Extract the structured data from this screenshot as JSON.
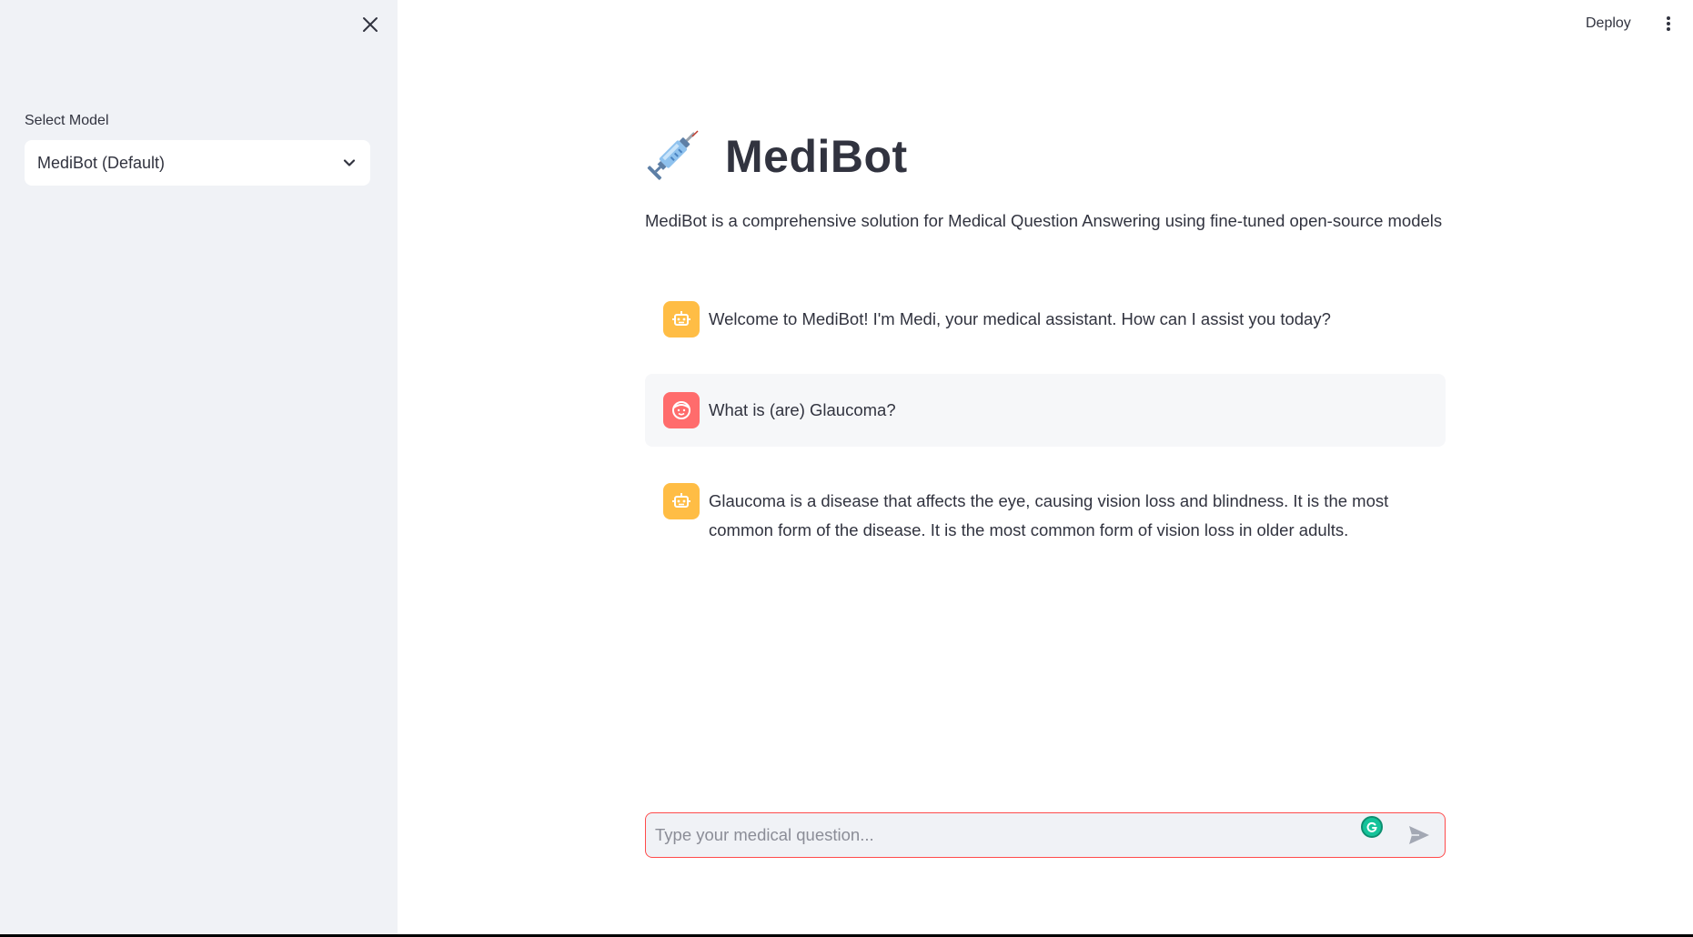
{
  "sidebar": {
    "select_label": "Select Model",
    "model_value": "MediBot (Default)"
  },
  "header": {
    "deploy_label": "Deploy"
  },
  "main": {
    "title": "MediBot",
    "description": "MediBot is a comprehensive solution for Medical Question Answering using fine-tuned open-source models"
  },
  "messages": [
    {
      "role": "assistant",
      "text": "Welcome to MediBot! I'm Medi, your medical assistant. How can I assist you today?"
    },
    {
      "role": "user",
      "text": "What is (are) Glaucoma?"
    },
    {
      "role": "assistant",
      "text": "Glaucoma is a disease that affects the eye, causing vision loss and blindness. It is the most common form of the disease. It is the most common form of vision loss in older adults."
    }
  ],
  "chat_input": {
    "placeholder": "Type your medical question...",
    "value": ""
  },
  "icons": {
    "title": "syringe-icon",
    "close": "close-icon",
    "chevron": "chevron-down-icon",
    "menu": "more-vertical-icon",
    "assistant_avatar": "robot-icon",
    "user_avatar": "smiley-face-icon",
    "send": "send-icon",
    "extension": "grammarly-icon"
  },
  "colors": {
    "sidebar_bg": "#f0f2f6",
    "assistant_avatar": "#ffbd45",
    "user_avatar": "#ff6c6c",
    "input_border": "#ff4b4b",
    "user_msg_bg": "#f6f7f9",
    "text": "#31333f"
  }
}
